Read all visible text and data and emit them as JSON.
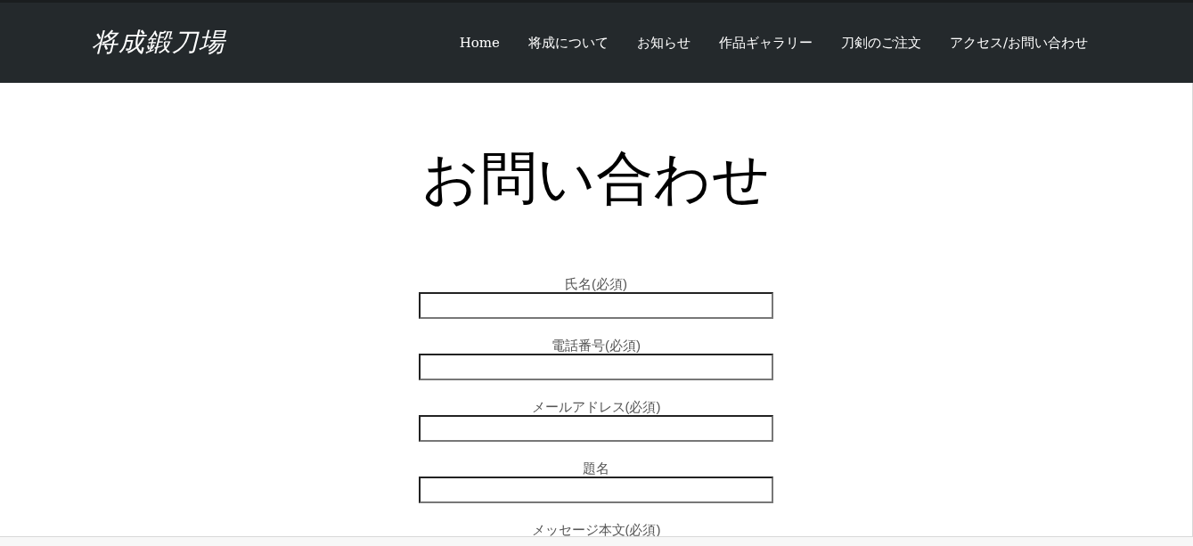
{
  "header": {
    "logo": "将成鍛刀場",
    "nav": [
      "Home",
      "将成について",
      "お知らせ",
      "作品ギャラリー",
      "刀剣のご注文",
      "アクセス/お問い合わせ"
    ]
  },
  "page": {
    "title": "お問い合わせ",
    "fields": [
      {
        "label": "氏名(必須)"
      },
      {
        "label": "電話番号(必須)"
      },
      {
        "label": "メールアドレス(必須)"
      },
      {
        "label": "題名"
      }
    ],
    "next_label": "メッセージ本文(必須)"
  }
}
